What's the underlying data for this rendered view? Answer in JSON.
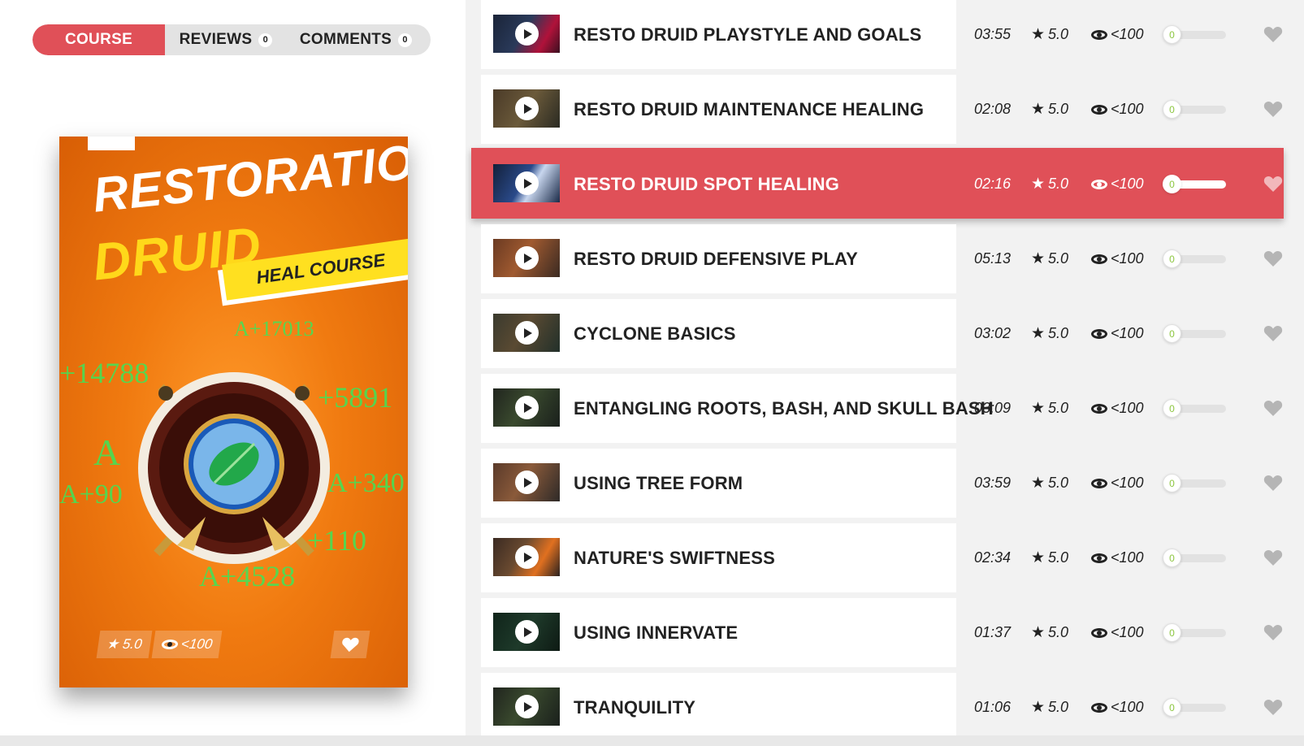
{
  "tabs": {
    "course": "COURSE",
    "reviews": "REVIEWS",
    "reviews_count": "0",
    "comments": "COMMENTS",
    "comments_count": "0"
  },
  "poster": {
    "title_line1": "RESTORATION",
    "title_line2": "DRUID",
    "band": "HEAL COURSE",
    "rating": "5.0",
    "views": "<100",
    "numbers": [
      "A+17013",
      "+14788",
      "+5891",
      "A",
      "A+90",
      "A+340",
      "+110",
      "A+4528"
    ]
  },
  "lessons": [
    {
      "title": "RESTO DRUID PLAYSTYLE AND GOALS",
      "duration": "03:55",
      "rating": "5.0",
      "views": "<100",
      "progress": "0"
    },
    {
      "title": "RESTO DRUID MAINTENANCE HEALING",
      "duration": "02:08",
      "rating": "5.0",
      "views": "<100",
      "progress": "0"
    },
    {
      "title": "RESTO DRUID SPOT HEALING",
      "duration": "02:16",
      "rating": "5.0",
      "views": "<100",
      "progress": "0"
    },
    {
      "title": "RESTO DRUID DEFENSIVE PLAY",
      "duration": "05:13",
      "rating": "5.0",
      "views": "<100",
      "progress": "0"
    },
    {
      "title": "CYCLONE BASICS",
      "duration": "03:02",
      "rating": "5.0",
      "views": "<100",
      "progress": "0"
    },
    {
      "title": "ENTANGLING ROOTS, BASH, AND SKULL BASH",
      "duration": "03:09",
      "rating": "5.0",
      "views": "<100",
      "progress": "0"
    },
    {
      "title": "USING TREE FORM",
      "duration": "03:59",
      "rating": "5.0",
      "views": "<100",
      "progress": "0"
    },
    {
      "title": "NATURE'S SWIFTNESS",
      "duration": "02:34",
      "rating": "5.0",
      "views": "<100",
      "progress": "0"
    },
    {
      "title": "USING INNERVATE",
      "duration": "01:37",
      "rating": "5.0",
      "views": "<100",
      "progress": "0"
    },
    {
      "title": "TRANQUILITY",
      "duration": "01:06",
      "rating": "5.0",
      "views": "<100",
      "progress": "0"
    }
  ],
  "active_lesson_index": 2,
  "colors": {
    "accent": "#e05058",
    "progress_text": "#8cc63f",
    "poster_orange": "#f07a10",
    "poster_yellow": "#ffd81a"
  },
  "icons": {
    "play": "play-icon",
    "star": "star-icon",
    "eye": "eye-icon",
    "heart": "heart-icon"
  }
}
